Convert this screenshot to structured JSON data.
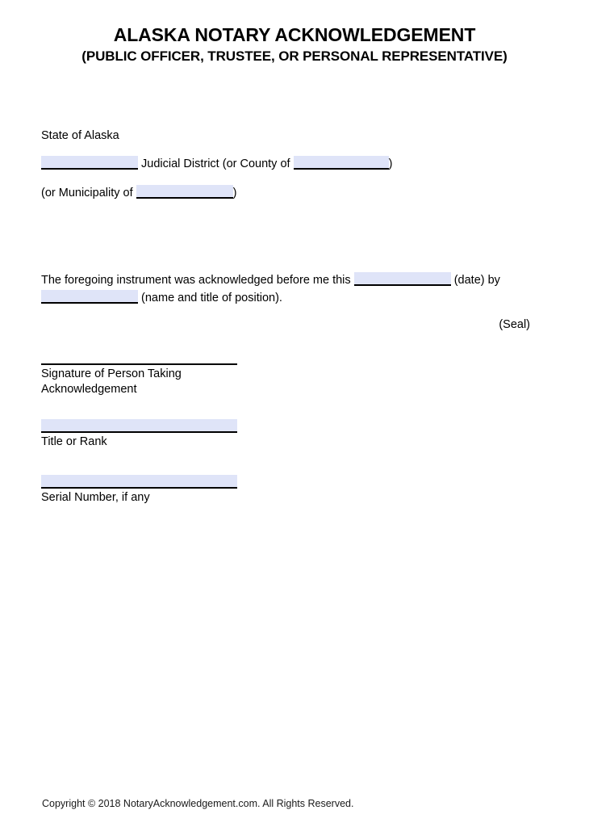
{
  "document": {
    "title": "ALASKA NOTARY ACKNOWLEDGEMENT",
    "subtitle": "(PUBLIC OFFICER, TRUSTEE, OR PERSONAL REPRESENTATIVE)"
  },
  "venue": {
    "state_line": "State of Alaska",
    "district_label_after": " Judicial District (or County of ",
    "district_line_close": ")",
    "municipality_prefix": "(or Municipality of ",
    "municipality_close": ")"
  },
  "acknowledgement": {
    "text_before_date": "The foregoing instrument was acknowledged before me this ",
    "text_after_date": " (date) by ",
    "text_after_name": " (name and title of position).",
    "seal": "(Seal)"
  },
  "signature_block": {
    "signature_label": "Signature of Person Taking\nAcknowledgement",
    "title_rank_label": "Title or Rank",
    "serial_number_label": "Serial Number, if any"
  },
  "fields": {
    "judicial_district": "",
    "county": "",
    "municipality": "",
    "date": "",
    "name_and_title": "",
    "title_or_rank": "",
    "serial_number": ""
  },
  "footer": {
    "copyright": "Copyright © 2018 NotaryAcknowledgement.com. All Rights Reserved."
  },
  "colors": {
    "field_fill": "#dfe4f8",
    "rule": "#000000",
    "text": "#000000"
  }
}
